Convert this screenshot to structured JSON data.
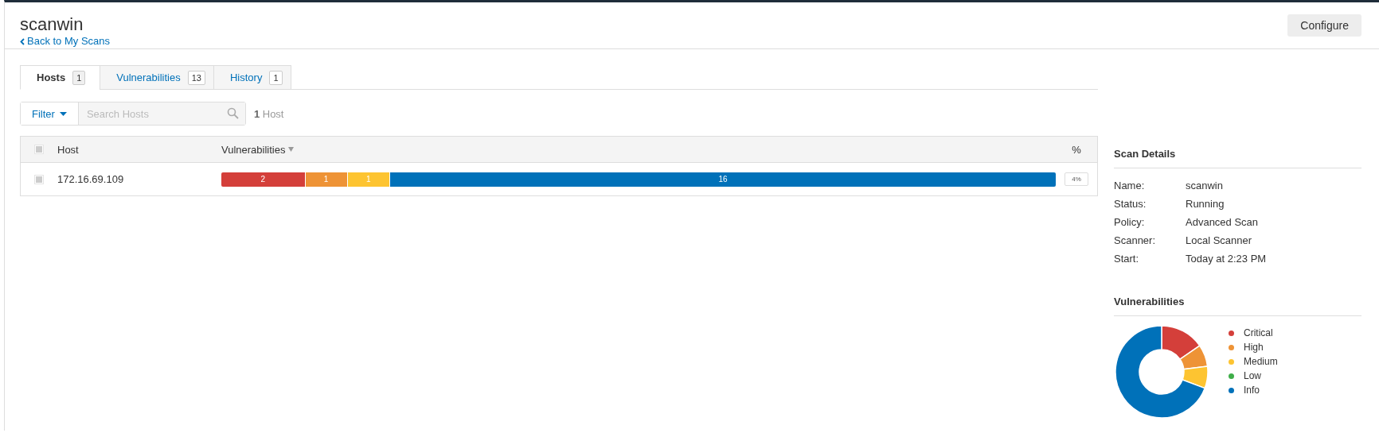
{
  "header": {
    "title": "scanwin",
    "back_link": "Back to My Scans",
    "configure_button": "Configure"
  },
  "tabs": [
    {
      "label": "Hosts",
      "count": "1",
      "selected": true
    },
    {
      "label": "Vulnerabilities",
      "count": "13",
      "selected": false
    },
    {
      "label": "History",
      "count": "1",
      "selected": false
    }
  ],
  "filter": {
    "button": "Filter",
    "placeholder": "Search Hosts",
    "result_count": "1",
    "result_label": "Host"
  },
  "table": {
    "select_all_checked": false,
    "columns": [
      "Host",
      "Vulnerabilities",
      "%"
    ],
    "rows": [
      {
        "checked": false,
        "host": "172.16.69.109",
        "percent": "4%",
        "segments": [
          {
            "count": "2",
            "color": "#d43f3a"
          },
          {
            "count": "1",
            "color": "#ee9336"
          },
          {
            "count": "1",
            "color": "#fdc431"
          },
          {
            "count": "16",
            "color": "#0071b9"
          }
        ]
      }
    ]
  },
  "scan_details": {
    "title": "Scan Details",
    "fields": [
      {
        "label": "Name:",
        "value": "scanwin"
      },
      {
        "label": "Status:",
        "value": "Running"
      },
      {
        "label": "Policy:",
        "value": "Advanced Scan"
      },
      {
        "label": "Scanner:",
        "value": "Local Scanner"
      },
      {
        "label": "Start:",
        "value": "Today at 2:23 PM"
      }
    ]
  },
  "vulnerabilities": {
    "title": "Vulnerabilities",
    "chart_data": {
      "type": "donut",
      "values": [
        15.4,
        7.7,
        7.7,
        0,
        69.2
      ]
    },
    "legend": [
      {
        "label": "Critical",
        "color": "#d43f3a"
      },
      {
        "label": "High",
        "color": "#ee9336"
      },
      {
        "label": "Medium",
        "color": "#fdc431"
      },
      {
        "label": "Low",
        "color": "#3fae49"
      },
      {
        "label": "Info",
        "color": "#0071b9"
      }
    ]
  }
}
